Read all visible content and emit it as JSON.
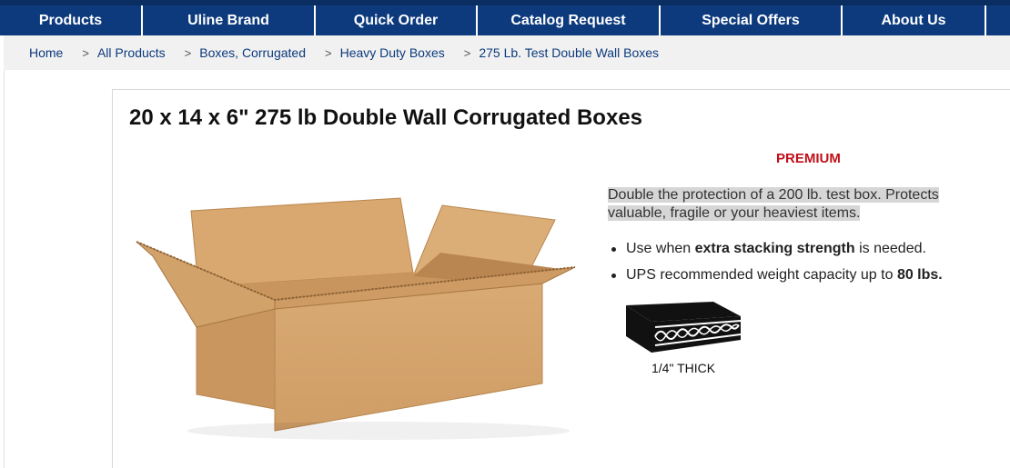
{
  "nav": {
    "items": [
      {
        "label": "Products"
      },
      {
        "label": "Uline Brand"
      },
      {
        "label": "Quick Order"
      },
      {
        "label": "Catalog Request"
      },
      {
        "label": "Special Offers"
      },
      {
        "label": "About Us"
      }
    ]
  },
  "breadcrumb": {
    "items": [
      {
        "label": "Home"
      },
      {
        "label": "All Products"
      },
      {
        "label": "Boxes, Corrugated"
      },
      {
        "label": "Heavy Duty Boxes"
      },
      {
        "label": "275 Lb. Test Double Wall Boxes"
      }
    ],
    "separator": ">"
  },
  "product": {
    "title": "20 x 14 x 6\" 275 lb Double Wall Corrugated Boxes",
    "badge": "PREMIUM",
    "description": "Double the protection of a 200 lb. test box. Protects valuable, fragile or your heaviest items.",
    "bullets": [
      {
        "before": "Use when ",
        "bold": "extra stacking strength",
        "after": " is needed."
      },
      {
        "before": "UPS recommended weight capacity up to ",
        "bold": "80 lbs.",
        "after": ""
      }
    ],
    "thickness_label": "1/4\" THICK"
  },
  "colors": {
    "nav_bg": "#0c3a7d",
    "badge": "#c0101a",
    "link": "#0c3a7d",
    "cardboard": "#d4a56f"
  }
}
